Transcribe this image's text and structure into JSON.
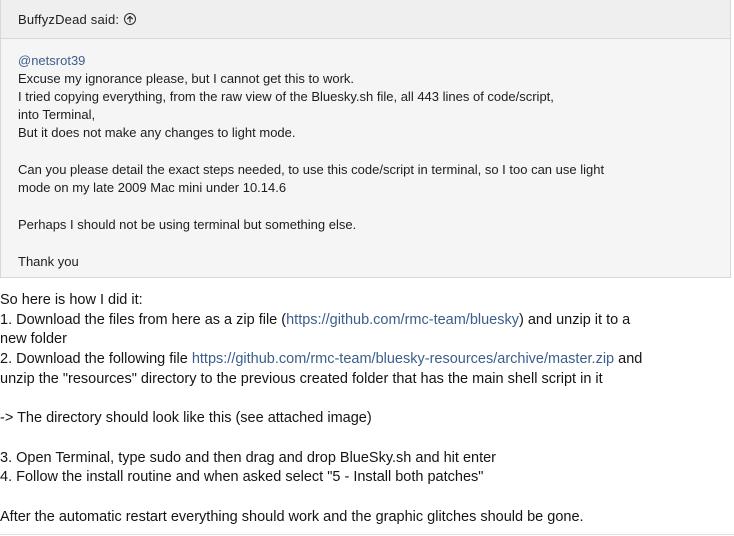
{
  "quote": {
    "author": "BuffyzDead said:",
    "jump_icon": "arrow-up-circle-icon",
    "mention": "@netsrot39",
    "lines": [
      "Excuse my ignorance please, but I cannot get this to work.",
      "I tried copying everything, from the raw view of the Bluesky.sh file, all 443 lines of code/script,",
      "into Terminal,",
      "But it does not make any changes to light mode."
    ],
    "paragraph2": [
      "Can you please detail the exact steps needed, to use this code/script in terminal, so I too can use light",
      "mode on my late 2009 Mac mini under 10.14.6"
    ],
    "paragraph3": "Perhaps I should not be using terminal but something else.",
    "thanks": "Thank you"
  },
  "reply": {
    "intro": "So here is how I did it:",
    "step1_pre": "1. Download the files from here as a zip file (",
    "step1_link": "https://github.com/rmc-team/bluesky",
    "step1_post": ") and unzip it to a",
    "step1_cont": "new folder",
    "step2_pre": "2. Download the following file ",
    "step2_link": "https://github.com/rmc-team/bluesky-resources/archive/master.zip",
    "step2_post": " and",
    "step2_cont": "unzip the \"resources\" directory to the previous created folder that has the main shell script in it",
    "note": "-> The directory should look like this (see attached image)",
    "step3": "3. Open Terminal, type sudo and then drag and drop BlueSky.sh and hit enter",
    "step4": "4. Follow the install routine and when asked select \"5 - Install both patches\"",
    "closing": "After the automatic restart everything should work and the graphic glitches should be gone."
  }
}
